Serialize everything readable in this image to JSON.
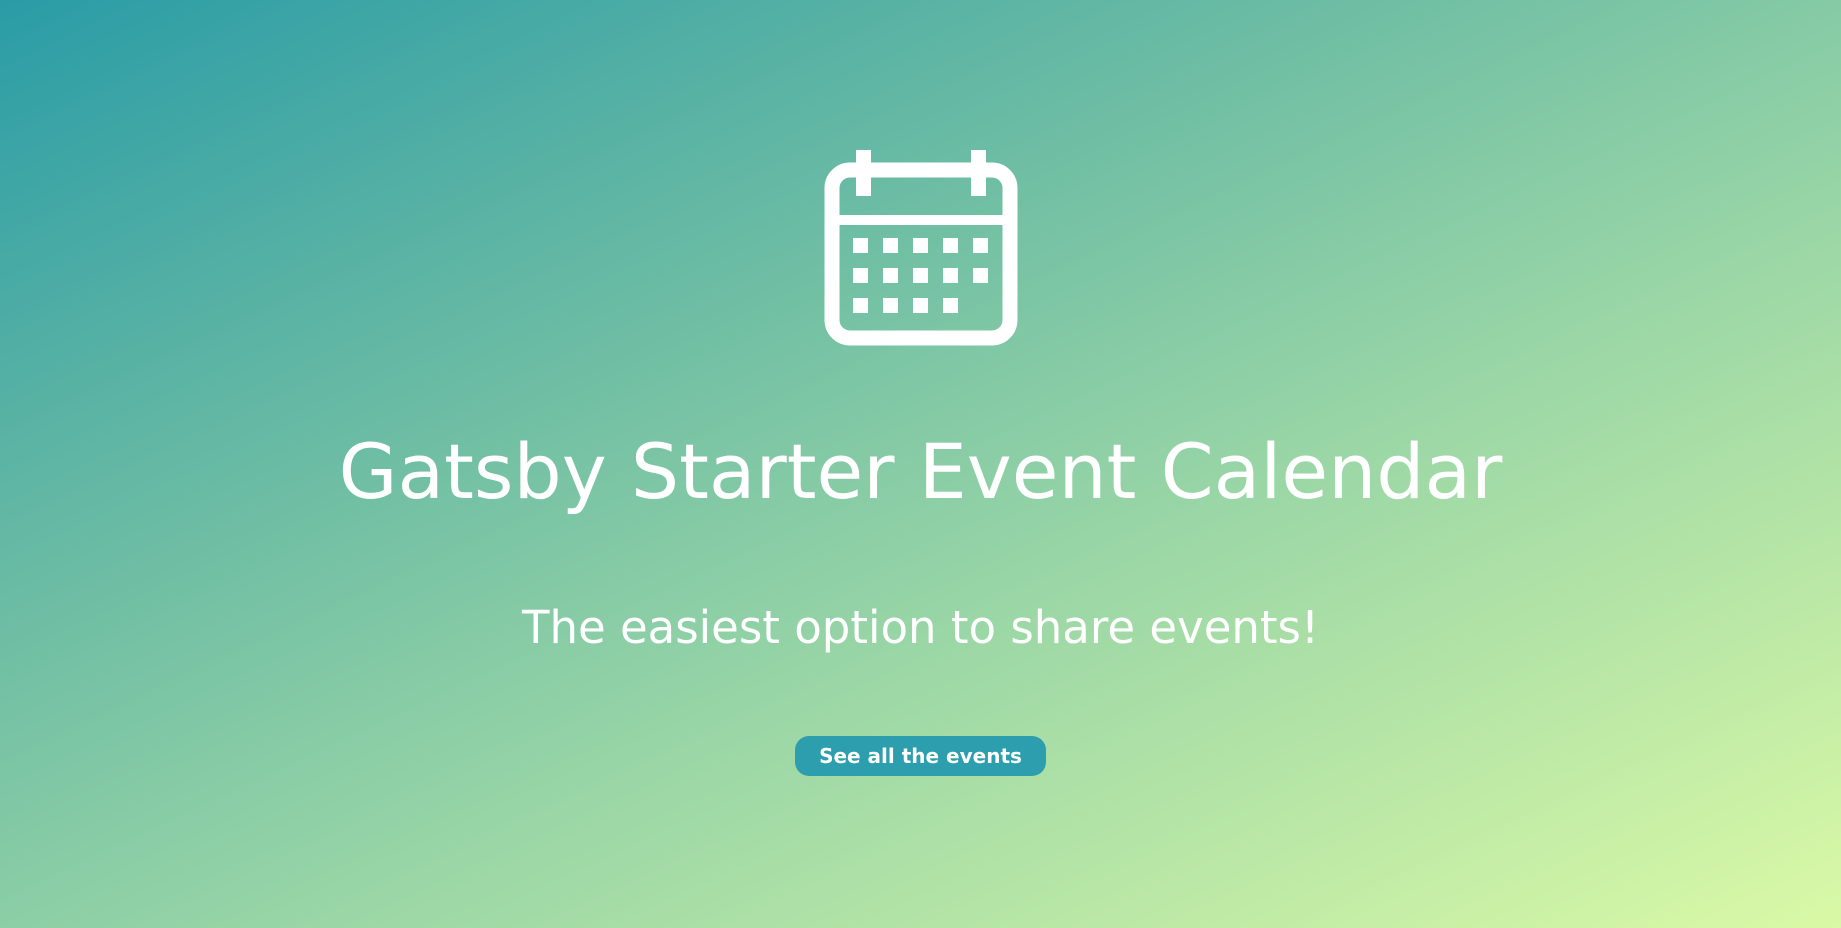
{
  "hero": {
    "icon": "calendar-icon",
    "title": "Gatsby Starter Event Calendar",
    "subtitle": "The easiest option to share events!",
    "cta_label": "See all the events"
  },
  "colors": {
    "gradient_start": "#2a9ca6",
    "gradient_end": "#daf9a6",
    "button_bg": "#2c9ead",
    "text": "#ffffff"
  }
}
